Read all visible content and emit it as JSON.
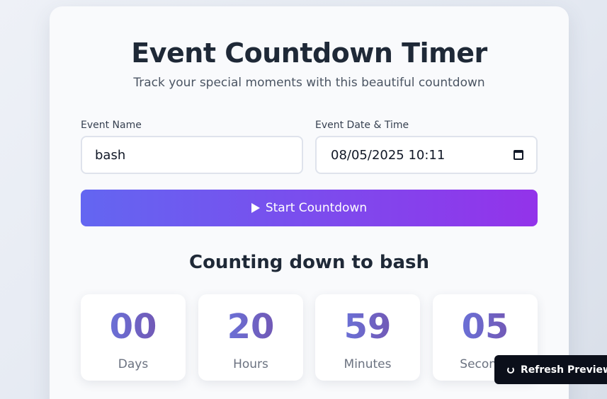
{
  "header": {
    "title": "Event Countdown Timer",
    "subtitle": "Track your special moments with this beautiful countdown"
  },
  "form": {
    "event_name_label": "Event Name",
    "event_name_value": "bash",
    "event_date_label": "Event Date & Time",
    "event_date_value": "08/05/2025 10:11",
    "start_button_label": "Start Countdown"
  },
  "countdown": {
    "heading": "Counting down to bash",
    "units": [
      {
        "value": "00",
        "label": "Days"
      },
      {
        "value": "20",
        "label": "Hours"
      },
      {
        "value": "59",
        "label": "Minutes"
      },
      {
        "value": "05",
        "label": "Seconds"
      }
    ]
  },
  "overlay": {
    "refresh_label": "Refresh Preview"
  },
  "icons": {
    "start": "play-icon",
    "date": "calendar-icon",
    "refresh": "refresh-icon"
  },
  "colors": {
    "accent_start": "#6366f1",
    "accent_end": "#9333ea",
    "number": "#6d5ec9"
  }
}
